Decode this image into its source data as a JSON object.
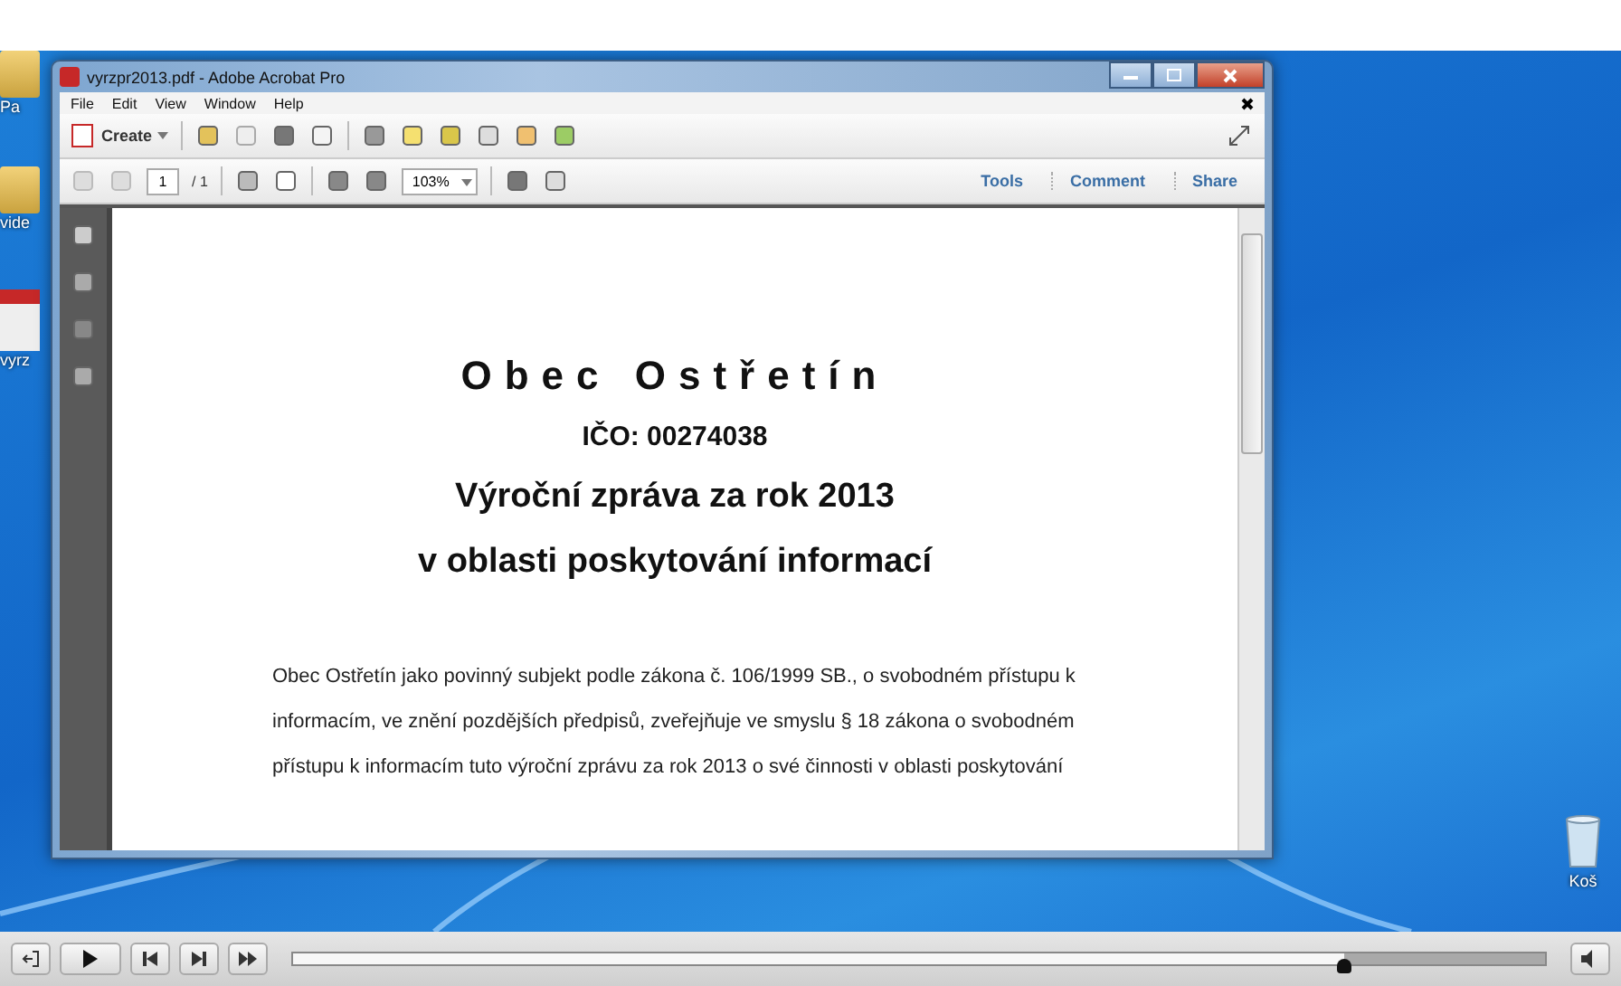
{
  "desktop": {
    "icons": [
      {
        "label": "Pa",
        "kind": "folder"
      },
      {
        "label": "vide",
        "kind": "folder"
      },
      {
        "label": "vyrz",
        "kind": "pdf"
      }
    ],
    "recycle_bin": {
      "label": "Koš"
    }
  },
  "window": {
    "title": "vyrzpr2013.pdf - Adobe Acrobat Pro",
    "menu": [
      "File",
      "Edit",
      "View",
      "Window",
      "Help"
    ],
    "toolbar": {
      "create": "Create"
    },
    "nav": {
      "page": "1",
      "total": "/ 1",
      "zoom": "103%",
      "panes": [
        "Tools",
        "Comment",
        "Share"
      ]
    },
    "document": {
      "title": "Obec Ostřetín",
      "ico": "IČO: 00274038",
      "heading": "Výroční zpráva za rok 2013",
      "subheading": "v oblasti poskytování informací",
      "paragraph": "Obec Ostřetín jako povinný subjekt podle zákona č. 106/1999 SB., o svobodném přístupu k informacím, ve znění pozdějších předpisů, zveřejňuje ve smyslu § 18 zákona o svobodném přístupu k informacím tuto výroční zprávu za rok 2013 o své činnosti v oblasti poskytování"
    }
  },
  "player": {
    "seek": {
      "level": 0.84
    }
  }
}
